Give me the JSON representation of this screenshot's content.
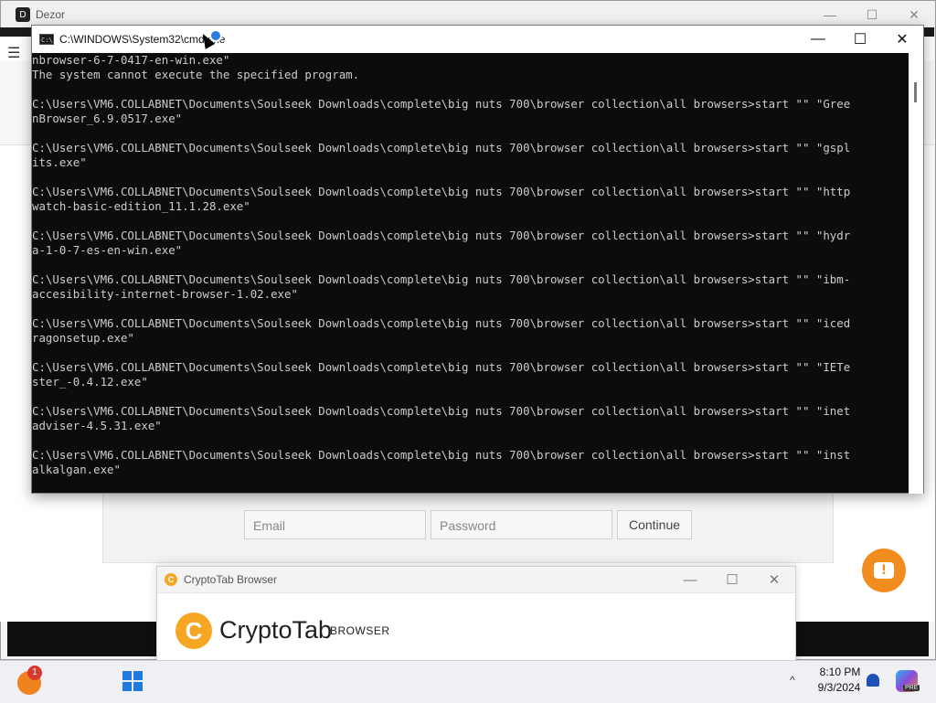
{
  "dezor": {
    "title": "Dezor",
    "logo_letter": "D",
    "menu_glyph": "☰",
    "controls": {
      "minimize": "—",
      "maximize": "☐",
      "close": "✕"
    },
    "login": {
      "email_placeholder": "Email",
      "password_placeholder": "Password",
      "continue_label": "Continue"
    },
    "feedback_icon": "!"
  },
  "cmd": {
    "title": "C:\\WINDOWS\\System32\\cmd.exe",
    "icon_text": "C:\\",
    "controls": {
      "minimize": "—",
      "maximize": "☐",
      "close": "✕"
    },
    "lines": [
      "nbrowser-6-7-0417-en-win.exe\"",
      "The system cannot execute the specified program.",
      "",
      "C:\\Users\\VM6.COLLABNET\\Documents\\Soulseek Downloads\\complete\\big nuts 700\\browser collection\\all browsers>start \"\" \"Gree",
      "nBrowser_6.9.0517.exe\"",
      "",
      "C:\\Users\\VM6.COLLABNET\\Documents\\Soulseek Downloads\\complete\\big nuts 700\\browser collection\\all browsers>start \"\" \"gspl",
      "its.exe\"",
      "",
      "C:\\Users\\VM6.COLLABNET\\Documents\\Soulseek Downloads\\complete\\big nuts 700\\browser collection\\all browsers>start \"\" \"http",
      "watch-basic-edition_11.1.28.exe\"",
      "",
      "C:\\Users\\VM6.COLLABNET\\Documents\\Soulseek Downloads\\complete\\big nuts 700\\browser collection\\all browsers>start \"\" \"hydr",
      "a-1-0-7-es-en-win.exe\"",
      "",
      "C:\\Users\\VM6.COLLABNET\\Documents\\Soulseek Downloads\\complete\\big nuts 700\\browser collection\\all browsers>start \"\" \"ibm-",
      "accesibility-internet-browser-1.02.exe\"",
      "",
      "C:\\Users\\VM6.COLLABNET\\Documents\\Soulseek Downloads\\complete\\big nuts 700\\browser collection\\all browsers>start \"\" \"iced",
      "ragonsetup.exe\"",
      "",
      "C:\\Users\\VM6.COLLABNET\\Documents\\Soulseek Downloads\\complete\\big nuts 700\\browser collection\\all browsers>start \"\" \"IETe",
      "ster_-0.4.12.exe\"",
      "",
      "C:\\Users\\VM6.COLLABNET\\Documents\\Soulseek Downloads\\complete\\big nuts 700\\browser collection\\all browsers>start \"\" \"inet",
      "adviser-4.5.31.exe\"",
      "",
      "C:\\Users\\VM6.COLLABNET\\Documents\\Soulseek Downloads\\complete\\big nuts 700\\browser collection\\all browsers>start \"\" \"inst",
      "alkalgan.exe\""
    ]
  },
  "cryptotab": {
    "title": "CryptoTab Browser",
    "brand_word": "CryptoTab",
    "brand_sub": "BROWSER",
    "logo_glyph": "C",
    "controls": {
      "minimize": "—",
      "maximize": "☐",
      "close": "✕"
    }
  },
  "taskbar": {
    "notification_badge": "1",
    "chevron": "^",
    "time": "8:10 PM",
    "date": "9/3/2024",
    "copilot_tag": "PRE"
  },
  "colors": {
    "accent_orange": "#f28c1f",
    "cmd_background": "#0c0c0c",
    "cmd_text": "#cccccc",
    "windows_blue": "#1f7ae0"
  }
}
